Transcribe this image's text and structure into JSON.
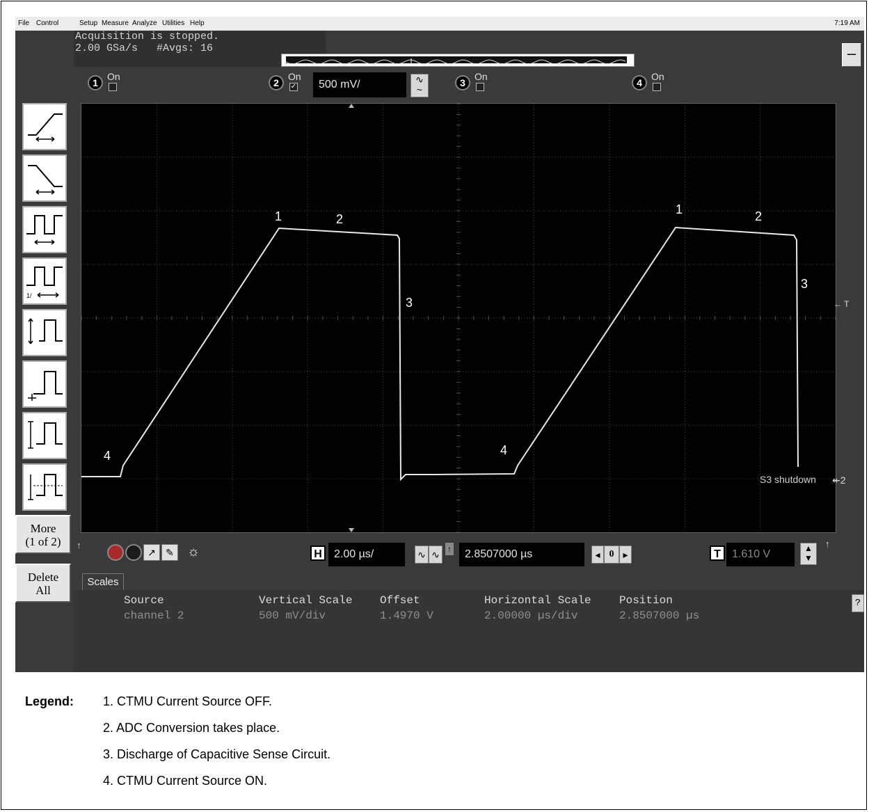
{
  "menubar": {
    "items": [
      "File",
      "Control",
      "Setup",
      "Measure",
      "Analyze",
      "Utilities",
      "Help"
    ],
    "clock": "7:19 AM"
  },
  "status": {
    "line1": "Acquisition is stopped.",
    "line2": "2.00 GSa/s   #Avgs: 16"
  },
  "minimize_label": "–",
  "channels": [
    {
      "number": "1",
      "on_label": "On",
      "checked": false
    },
    {
      "number": "2",
      "on_label": "On",
      "checked": true,
      "scale": "500 mV/"
    },
    {
      "number": "3",
      "on_label": "On",
      "checked": false
    },
    {
      "number": "4",
      "on_label": "On",
      "checked": false
    }
  ],
  "sidebar": {
    "more_label_line1": "More",
    "more_label_line2": "(1 of 2)",
    "delete_label_line1": "Delete",
    "delete_label_line2": "All"
  },
  "waveform": {
    "markers": [
      "1",
      "2",
      "3",
      "4",
      "1",
      "2",
      "3",
      "4"
    ],
    "trigger_marker": "← T",
    "annotation": "S3 shutdown",
    "ground_marker": "↞2"
  },
  "controls": {
    "h_badge": "H",
    "h_scale": "2.00 µs/",
    "h_position": "2.8507000 µs",
    "zero_label": "0",
    "t_badge": "T",
    "t_level": "1.610 V"
  },
  "scales": {
    "tab_label": "Scales",
    "headers": [
      "Source",
      "Vertical Scale",
      "Offset",
      "Horizontal Scale",
      "Position"
    ],
    "values": [
      "channel 2",
      "500 mV/div",
      "1.4970 V",
      "2.00000 µs/div",
      "2.8507000 µs"
    ],
    "help_label": "?"
  },
  "legend": {
    "title": "Legend:",
    "items": [
      "1. CTMU Current Source OFF.",
      "2. ADC Conversion takes place.",
      "3. Discharge of Capacitive Sense Circuit.",
      "4. CTMU Current Source ON."
    ]
  },
  "colors": {
    "trace": "#e8e8e8",
    "grid": "#505050",
    "screen": "#000000"
  }
}
